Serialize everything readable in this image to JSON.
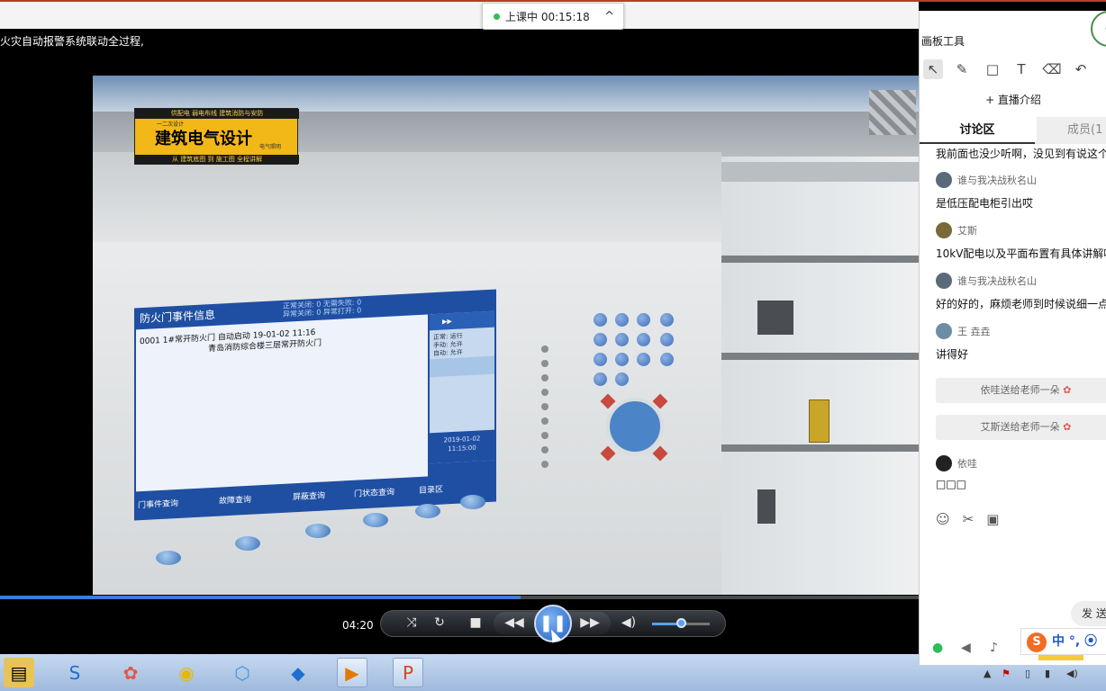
{
  "status": {
    "label": "上课中 00:15:18"
  },
  "title": "火灾自动报警系统联动全过程,",
  "video": {
    "logo": {
      "top": "供配电  弱电布线  建筑消防与安防",
      "sub": "一二次设计",
      "main": "建筑电气设计",
      "tag": "电气照明",
      "bottom": "从 建筑底图 到 施工图 全程讲解"
    },
    "screen": {
      "title": "防火门事件信息",
      "stats1": "正常关闭: 0    无需失败: 0",
      "stats2": "异常关闭: 0    异常打开: 0",
      "row1": "0001   1#常开防火门 自动启动          19-01-02 11:16",
      "row2": "青岛消防综合楼三层常开防火门",
      "side_lines": "正常: 运行\n手动: 允许\n自动: 允许",
      "clock": "2019-01-02\n11:15:00",
      "tabs": [
        "门事件查询",
        "故障查询",
        "屏蔽查询",
        "门状态查询",
        "目录区"
      ]
    }
  },
  "player": {
    "time": "04:20",
    "progress_fraction": 0.567,
    "volume_fraction": 0.5
  },
  "panel": {
    "title": "画板工具",
    "live_intro": "+ 直播介绍",
    "tab_active": "讨论区",
    "tab_other": "成员(1",
    "messages": [
      {
        "text": "我前面也没少听啊，没见到有说这个"
      },
      {
        "user": "谁与我决战秋名山",
        "text": "是低压配电柜引出哎"
      },
      {
        "user": "艾斯",
        "text": "10kV配电以及平面布置有具体讲解呢"
      },
      {
        "user": "谁与我决战秋名山",
        "text": "好的好的，麻烦老师到时候说细一点"
      },
      {
        "user": "王 垚垚",
        "text": "讲得好"
      }
    ],
    "gifts": [
      "依哇送给老师一朵",
      "艾斯送给老师一朵"
    ],
    "last_user": "依哇",
    "last_text": "□□□",
    "send_label": "发 送",
    "ime": {
      "mode": "中",
      "punct": "°,"
    }
  }
}
